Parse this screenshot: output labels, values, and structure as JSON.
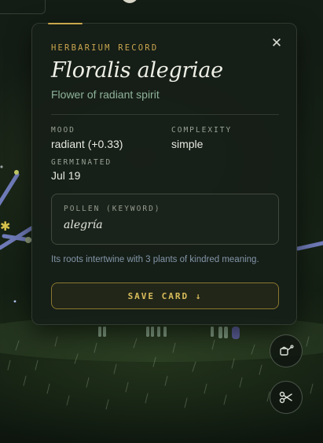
{
  "card": {
    "kicker": "HERBARIUM RECORD",
    "title": "Floralis alegriae",
    "subtitle": "Flower of radiant spirit",
    "close_icon": "close-icon",
    "stats": {
      "mood_label": "MOOD",
      "mood_value": "radiant (+0.33)",
      "complexity_label": "COMPLEXITY",
      "complexity_value": "simple",
      "germinated_label": "GERMINATED",
      "germinated_value": "Jul 19"
    },
    "pollen": {
      "label": "POLLEN (KEYWORD)",
      "value": "alegría"
    },
    "roots_text": "Its roots intertwine with 3 plants of kindred meaning.",
    "save_label": "SAVE CARD ↓"
  },
  "tools": {
    "watering_icon": "watering-can-icon",
    "scissors_icon": "scissors-icon"
  },
  "colors": {
    "accent_gold": "#c9a54e",
    "subtitle_green": "#8fb39a",
    "roots_blue": "#8396a8",
    "background": "#101a12"
  }
}
